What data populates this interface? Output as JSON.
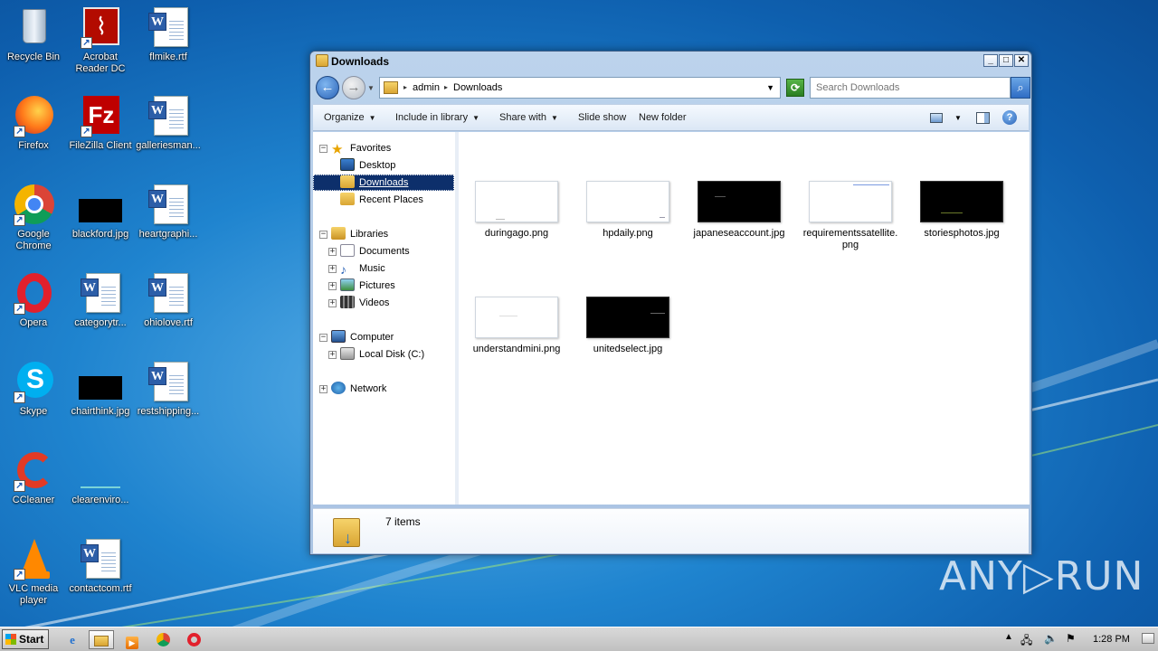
{
  "desktop": {
    "icons": [
      {
        "label": "Recycle Bin",
        "icon": "recycle-bin-icon"
      },
      {
        "label": "Acrobat Reader DC",
        "icon": "acrobat-icon"
      },
      {
        "label": "flmike.rtf",
        "icon": "word-doc-icon"
      },
      {
        "label": "Firefox",
        "icon": "firefox-icon"
      },
      {
        "label": "FileZilla Client",
        "icon": "filezilla-icon"
      },
      {
        "label": "galleriesman...",
        "icon": "word-doc-icon"
      },
      {
        "label": "Google Chrome",
        "icon": "chrome-icon"
      },
      {
        "label": "blackford.jpg",
        "icon": "image-icon"
      },
      {
        "label": "heartgraphi...",
        "icon": "word-doc-icon"
      },
      {
        "label": "Opera",
        "icon": "opera-icon"
      },
      {
        "label": "categorytr...",
        "icon": "word-doc-icon"
      },
      {
        "label": "ohiolove.rtf",
        "icon": "word-doc-icon"
      },
      {
        "label": "Skype",
        "icon": "skype-icon"
      },
      {
        "label": "chairthink.jpg",
        "icon": "image-icon"
      },
      {
        "label": "restshipping...",
        "icon": "word-doc-icon"
      },
      {
        "label": "CCleaner",
        "icon": "ccleaner-icon"
      },
      {
        "label": "clearenviro...",
        "icon": "image-icon"
      },
      {
        "label": "VLC media player",
        "icon": "vlc-icon"
      },
      {
        "label": "contactcom.rtf",
        "icon": "word-doc-icon"
      }
    ]
  },
  "window": {
    "title": "Downloads",
    "address": {
      "crumbs": [
        "admin",
        "Downloads"
      ]
    },
    "search": {
      "placeholder": "Search Downloads"
    },
    "toolbar": {
      "organize": "Organize",
      "include_in_library": "Include in library",
      "share_with": "Share with",
      "slide_show": "Slide show",
      "new_folder": "New folder"
    },
    "nav": {
      "favorites": "Favorites",
      "desktop": "Desktop",
      "downloads": "Downloads",
      "recent_places": "Recent Places",
      "libraries": "Libraries",
      "documents": "Documents",
      "music": "Music",
      "pictures": "Pictures",
      "videos": "Videos",
      "computer": "Computer",
      "local_disk": "Local Disk (C:)",
      "network": "Network"
    },
    "files": [
      {
        "name": "duringago.png",
        "thumb": "white"
      },
      {
        "name": "hpdaily.png",
        "thumb": "white"
      },
      {
        "name": "japaneseaccount.jpg",
        "thumb": "black"
      },
      {
        "name": "requirementssatellite.png",
        "thumb": "white"
      },
      {
        "name": "storiesphotos.jpg",
        "thumb": "black"
      },
      {
        "name": "understandmini.png",
        "thumb": "white"
      },
      {
        "name": "unitedselect.jpg",
        "thumb": "black"
      }
    ],
    "status": {
      "item_count": "7 items"
    }
  },
  "taskbar": {
    "start_label": "Start",
    "clock": "1:28 PM"
  },
  "watermark": "ANY▷RUN",
  "colors": {
    "accent": "#0d2f6b",
    "desktop": "#1f84cf"
  }
}
